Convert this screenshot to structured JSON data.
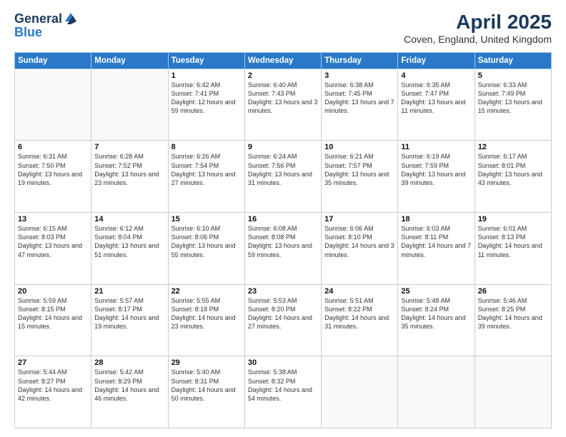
{
  "header": {
    "logo_general": "General",
    "logo_blue": "Blue",
    "title": "April 2025",
    "subtitle": "Coven, England, United Kingdom"
  },
  "days_of_week": [
    "Sunday",
    "Monday",
    "Tuesday",
    "Wednesday",
    "Thursday",
    "Friday",
    "Saturday"
  ],
  "weeks": [
    [
      {
        "day": null
      },
      {
        "day": null
      },
      {
        "day": 1,
        "sunrise": "Sunrise: 6:42 AM",
        "sunset": "Sunset: 7:41 PM",
        "daylight": "Daylight: 12 hours and 59 minutes."
      },
      {
        "day": 2,
        "sunrise": "Sunrise: 6:40 AM",
        "sunset": "Sunset: 7:43 PM",
        "daylight": "Daylight: 13 hours and 3 minutes."
      },
      {
        "day": 3,
        "sunrise": "Sunrise: 6:38 AM",
        "sunset": "Sunset: 7:45 PM",
        "daylight": "Daylight: 13 hours and 7 minutes."
      },
      {
        "day": 4,
        "sunrise": "Sunrise: 6:35 AM",
        "sunset": "Sunset: 7:47 PM",
        "daylight": "Daylight: 13 hours and 11 minutes."
      },
      {
        "day": 5,
        "sunrise": "Sunrise: 6:33 AM",
        "sunset": "Sunset: 7:49 PM",
        "daylight": "Daylight: 13 hours and 15 minutes."
      }
    ],
    [
      {
        "day": 6,
        "sunrise": "Sunrise: 6:31 AM",
        "sunset": "Sunset: 7:50 PM",
        "daylight": "Daylight: 13 hours and 19 minutes."
      },
      {
        "day": 7,
        "sunrise": "Sunrise: 6:28 AM",
        "sunset": "Sunset: 7:52 PM",
        "daylight": "Daylight: 13 hours and 23 minutes."
      },
      {
        "day": 8,
        "sunrise": "Sunrise: 6:26 AM",
        "sunset": "Sunset: 7:54 PM",
        "daylight": "Daylight: 13 hours and 27 minutes."
      },
      {
        "day": 9,
        "sunrise": "Sunrise: 6:24 AM",
        "sunset": "Sunset: 7:56 PM",
        "daylight": "Daylight: 13 hours and 31 minutes."
      },
      {
        "day": 10,
        "sunrise": "Sunrise: 6:21 AM",
        "sunset": "Sunset: 7:57 PM",
        "daylight": "Daylight: 13 hours and 35 minutes."
      },
      {
        "day": 11,
        "sunrise": "Sunrise: 6:19 AM",
        "sunset": "Sunset: 7:59 PM",
        "daylight": "Daylight: 13 hours and 39 minutes."
      },
      {
        "day": 12,
        "sunrise": "Sunrise: 6:17 AM",
        "sunset": "Sunset: 8:01 PM",
        "daylight": "Daylight: 13 hours and 43 minutes."
      }
    ],
    [
      {
        "day": 13,
        "sunrise": "Sunrise: 6:15 AM",
        "sunset": "Sunset: 8:03 PM",
        "daylight": "Daylight: 13 hours and 47 minutes."
      },
      {
        "day": 14,
        "sunrise": "Sunrise: 6:12 AM",
        "sunset": "Sunset: 8:04 PM",
        "daylight": "Daylight: 13 hours and 51 minutes."
      },
      {
        "day": 15,
        "sunrise": "Sunrise: 6:10 AM",
        "sunset": "Sunset: 8:06 PM",
        "daylight": "Daylight: 13 hours and 55 minutes."
      },
      {
        "day": 16,
        "sunrise": "Sunrise: 6:08 AM",
        "sunset": "Sunset: 8:08 PM",
        "daylight": "Daylight: 13 hours and 59 minutes."
      },
      {
        "day": 17,
        "sunrise": "Sunrise: 6:06 AM",
        "sunset": "Sunset: 8:10 PM",
        "daylight": "Daylight: 14 hours and 3 minutes."
      },
      {
        "day": 18,
        "sunrise": "Sunrise: 6:03 AM",
        "sunset": "Sunset: 8:11 PM",
        "daylight": "Daylight: 14 hours and 7 minutes."
      },
      {
        "day": 19,
        "sunrise": "Sunrise: 6:01 AM",
        "sunset": "Sunset: 8:13 PM",
        "daylight": "Daylight: 14 hours and 11 minutes."
      }
    ],
    [
      {
        "day": 20,
        "sunrise": "Sunrise: 5:59 AM",
        "sunset": "Sunset: 8:15 PM",
        "daylight": "Daylight: 14 hours and 15 minutes."
      },
      {
        "day": 21,
        "sunrise": "Sunrise: 5:57 AM",
        "sunset": "Sunset: 8:17 PM",
        "daylight": "Daylight: 14 hours and 19 minutes."
      },
      {
        "day": 22,
        "sunrise": "Sunrise: 5:55 AM",
        "sunset": "Sunset: 8:18 PM",
        "daylight": "Daylight: 14 hours and 23 minutes."
      },
      {
        "day": 23,
        "sunrise": "Sunrise: 5:53 AM",
        "sunset": "Sunset: 8:20 PM",
        "daylight": "Daylight: 14 hours and 27 minutes."
      },
      {
        "day": 24,
        "sunrise": "Sunrise: 5:51 AM",
        "sunset": "Sunset: 8:22 PM",
        "daylight": "Daylight: 14 hours and 31 minutes."
      },
      {
        "day": 25,
        "sunrise": "Sunrise: 5:48 AM",
        "sunset": "Sunset: 8:24 PM",
        "daylight": "Daylight: 14 hours and 35 minutes."
      },
      {
        "day": 26,
        "sunrise": "Sunrise: 5:46 AM",
        "sunset": "Sunset: 8:25 PM",
        "daylight": "Daylight: 14 hours and 39 minutes."
      }
    ],
    [
      {
        "day": 27,
        "sunrise": "Sunrise: 5:44 AM",
        "sunset": "Sunset: 8:27 PM",
        "daylight": "Daylight: 14 hours and 42 minutes."
      },
      {
        "day": 28,
        "sunrise": "Sunrise: 5:42 AM",
        "sunset": "Sunset: 8:29 PM",
        "daylight": "Daylight: 14 hours and 46 minutes."
      },
      {
        "day": 29,
        "sunrise": "Sunrise: 5:40 AM",
        "sunset": "Sunset: 8:31 PM",
        "daylight": "Daylight: 14 hours and 50 minutes."
      },
      {
        "day": 30,
        "sunrise": "Sunrise: 5:38 AM",
        "sunset": "Sunset: 8:32 PM",
        "daylight": "Daylight: 14 hours and 54 minutes."
      },
      {
        "day": null
      },
      {
        "day": null
      },
      {
        "day": null
      }
    ]
  ]
}
